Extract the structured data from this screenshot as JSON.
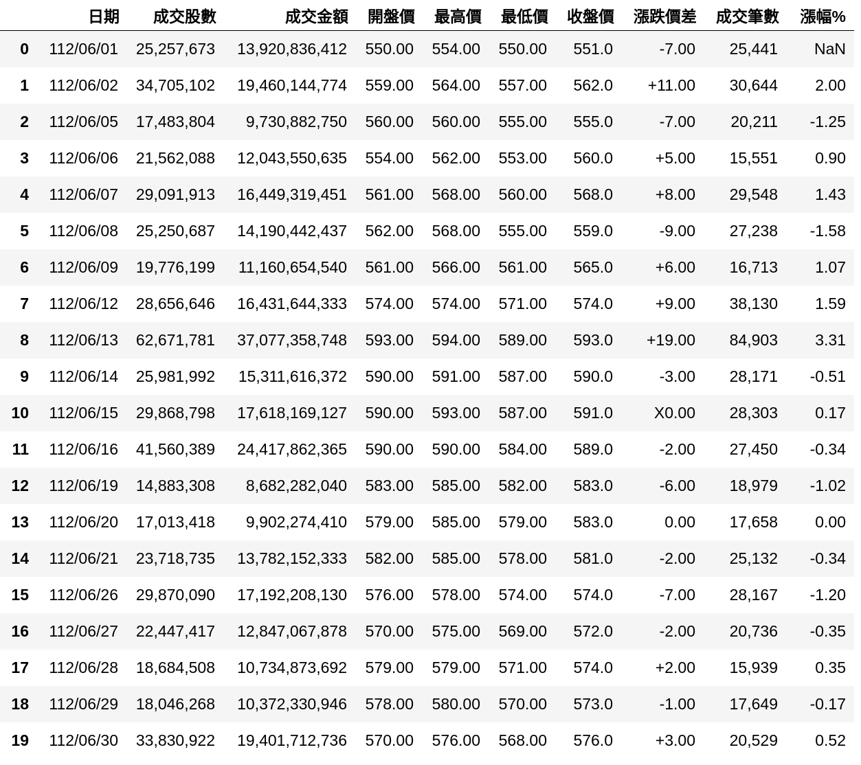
{
  "table": {
    "index_header": "",
    "columns": [
      "日期",
      "成交股數",
      "成交金額",
      "開盤價",
      "最高價",
      "最低價",
      "收盤價",
      "漲跌價差",
      "成交筆數",
      "漲幅%"
    ],
    "rows": [
      {
        "index": "0",
        "cells": [
          "112/06/01",
          "25,257,673",
          "13,920,836,412",
          "550.00",
          "554.00",
          "550.00",
          "551.0",
          "-7.00",
          "25,441",
          "NaN"
        ]
      },
      {
        "index": "1",
        "cells": [
          "112/06/02",
          "34,705,102",
          "19,460,144,774",
          "559.00",
          "564.00",
          "557.00",
          "562.0",
          "+11.00",
          "30,644",
          "2.00"
        ]
      },
      {
        "index": "2",
        "cells": [
          "112/06/05",
          "17,483,804",
          "9,730,882,750",
          "560.00",
          "560.00",
          "555.00",
          "555.0",
          "-7.00",
          "20,211",
          "-1.25"
        ]
      },
      {
        "index": "3",
        "cells": [
          "112/06/06",
          "21,562,088",
          "12,043,550,635",
          "554.00",
          "562.00",
          "553.00",
          "560.0",
          "+5.00",
          "15,551",
          "0.90"
        ]
      },
      {
        "index": "4",
        "cells": [
          "112/06/07",
          "29,091,913",
          "16,449,319,451",
          "561.00",
          "568.00",
          "560.00",
          "568.0",
          "+8.00",
          "29,548",
          "1.43"
        ]
      },
      {
        "index": "5",
        "cells": [
          "112/06/08",
          "25,250,687",
          "14,190,442,437",
          "562.00",
          "568.00",
          "555.00",
          "559.0",
          "-9.00",
          "27,238",
          "-1.58"
        ]
      },
      {
        "index": "6",
        "cells": [
          "112/06/09",
          "19,776,199",
          "11,160,654,540",
          "561.00",
          "566.00",
          "561.00",
          "565.0",
          "+6.00",
          "16,713",
          "1.07"
        ]
      },
      {
        "index": "7",
        "cells": [
          "112/06/12",
          "28,656,646",
          "16,431,644,333",
          "574.00",
          "574.00",
          "571.00",
          "574.0",
          "+9.00",
          "38,130",
          "1.59"
        ]
      },
      {
        "index": "8",
        "cells": [
          "112/06/13",
          "62,671,781",
          "37,077,358,748",
          "593.00",
          "594.00",
          "589.00",
          "593.0",
          "+19.00",
          "84,903",
          "3.31"
        ]
      },
      {
        "index": "9",
        "cells": [
          "112/06/14",
          "25,981,992",
          "15,311,616,372",
          "590.00",
          "591.00",
          "587.00",
          "590.0",
          "-3.00",
          "28,171",
          "-0.51"
        ]
      },
      {
        "index": "10",
        "cells": [
          "112/06/15",
          "29,868,798",
          "17,618,169,127",
          "590.00",
          "593.00",
          "587.00",
          "591.0",
          "X0.00",
          "28,303",
          "0.17"
        ]
      },
      {
        "index": "11",
        "cells": [
          "112/06/16",
          "41,560,389",
          "24,417,862,365",
          "590.00",
          "590.00",
          "584.00",
          "589.0",
          "-2.00",
          "27,450",
          "-0.34"
        ]
      },
      {
        "index": "12",
        "cells": [
          "112/06/19",
          "14,883,308",
          "8,682,282,040",
          "583.00",
          "585.00",
          "582.00",
          "583.0",
          "-6.00",
          "18,979",
          "-1.02"
        ]
      },
      {
        "index": "13",
        "cells": [
          "112/06/20",
          "17,013,418",
          "9,902,274,410",
          "579.00",
          "585.00",
          "579.00",
          "583.0",
          "0.00",
          "17,658",
          "0.00"
        ]
      },
      {
        "index": "14",
        "cells": [
          "112/06/21",
          "23,718,735",
          "13,782,152,333",
          "582.00",
          "585.00",
          "578.00",
          "581.0",
          "-2.00",
          "25,132",
          "-0.34"
        ]
      },
      {
        "index": "15",
        "cells": [
          "112/06/26",
          "29,870,090",
          "17,192,208,130",
          "576.00",
          "578.00",
          "574.00",
          "574.0",
          "-7.00",
          "28,167",
          "-1.20"
        ]
      },
      {
        "index": "16",
        "cells": [
          "112/06/27",
          "22,447,417",
          "12,847,067,878",
          "570.00",
          "575.00",
          "569.00",
          "572.0",
          "-2.00",
          "20,736",
          "-0.35"
        ]
      },
      {
        "index": "17",
        "cells": [
          "112/06/28",
          "18,684,508",
          "10,734,873,692",
          "579.00",
          "579.00",
          "571.00",
          "574.0",
          "+2.00",
          "15,939",
          "0.35"
        ]
      },
      {
        "index": "18",
        "cells": [
          "112/06/29",
          "18,046,268",
          "10,372,330,946",
          "578.00",
          "580.00",
          "570.00",
          "573.0",
          "-1.00",
          "17,649",
          "-0.17"
        ]
      },
      {
        "index": "19",
        "cells": [
          "112/06/30",
          "33,830,922",
          "19,401,712,736",
          "570.00",
          "576.00",
          "568.00",
          "576.0",
          "+3.00",
          "20,529",
          "0.52"
        ]
      }
    ]
  }
}
